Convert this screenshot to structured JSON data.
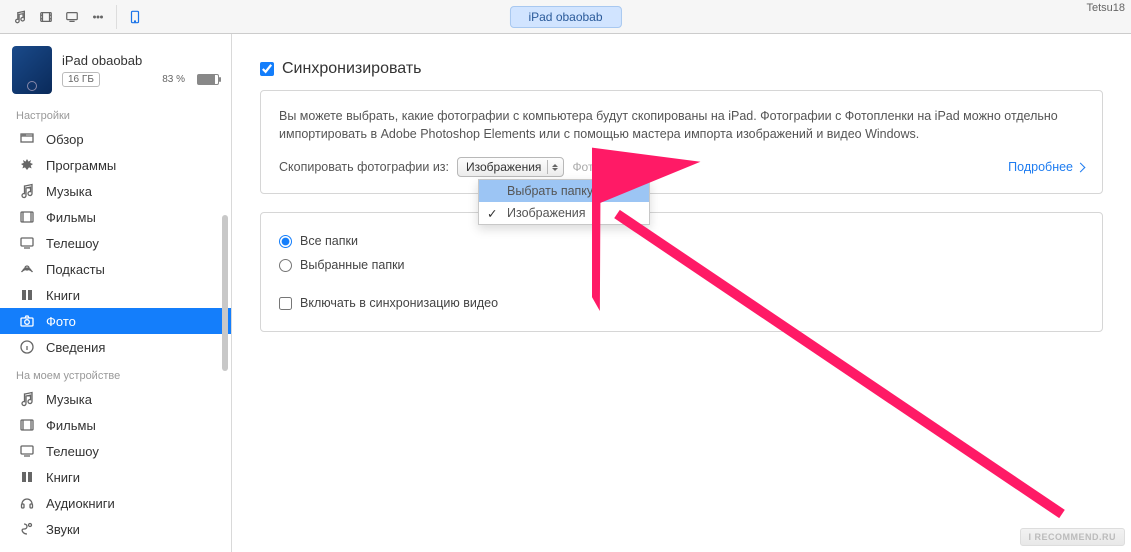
{
  "toolbar": {
    "device_tab": "iPad obaobab",
    "watermark_top": "Tetsu18"
  },
  "sidebar": {
    "device": {
      "name": "iPad obaobab",
      "capacity": "16 ГБ",
      "battery_pct": "83 %"
    },
    "section_settings": "Настройки",
    "settings_items": [
      {
        "label": "Обзор",
        "icon": "overview"
      },
      {
        "label": "Программы",
        "icon": "apps"
      },
      {
        "label": "Музыка",
        "icon": "music"
      },
      {
        "label": "Фильмы",
        "icon": "movies"
      },
      {
        "label": "Телешоу",
        "icon": "tv"
      },
      {
        "label": "Подкасты",
        "icon": "podcasts"
      },
      {
        "label": "Книги",
        "icon": "books"
      },
      {
        "label": "Фото",
        "icon": "photos",
        "selected": true
      },
      {
        "label": "Сведения",
        "icon": "info"
      }
    ],
    "section_device": "На моем устройстве",
    "device_items": [
      {
        "label": "Музыка",
        "icon": "music"
      },
      {
        "label": "Фильмы",
        "icon": "movies"
      },
      {
        "label": "Телешоу",
        "icon": "tv"
      },
      {
        "label": "Книги",
        "icon": "books"
      },
      {
        "label": "Аудиокниги",
        "icon": "audiobooks"
      },
      {
        "label": "Звуки",
        "icon": "sounds"
      }
    ]
  },
  "content": {
    "sync_label": "Синхронизировать",
    "info_text": "Вы можете выбрать, какие фотографии с компьютера будут скопированы на iPad. Фотографии с Фотопленки на iPad можно отдельно импортировать в Adobe Photoshop Elements или с помощью мастера импорта изображений и видео Windows.",
    "copy_label": "Скопировать фотографии из:",
    "dropdown_selected": "Изображения",
    "photos_count": "Фото: 0",
    "more_link": "Подробнее",
    "dropdown_options": {
      "choose_folder": "Выбрать папку…",
      "images": "Изображения"
    },
    "radio_all": "Все папки",
    "radio_selected": "Выбранные папки",
    "include_video": "Включать в синхронизацию видео"
  },
  "watermark_bottom": "I RECOMMEND.RU"
}
